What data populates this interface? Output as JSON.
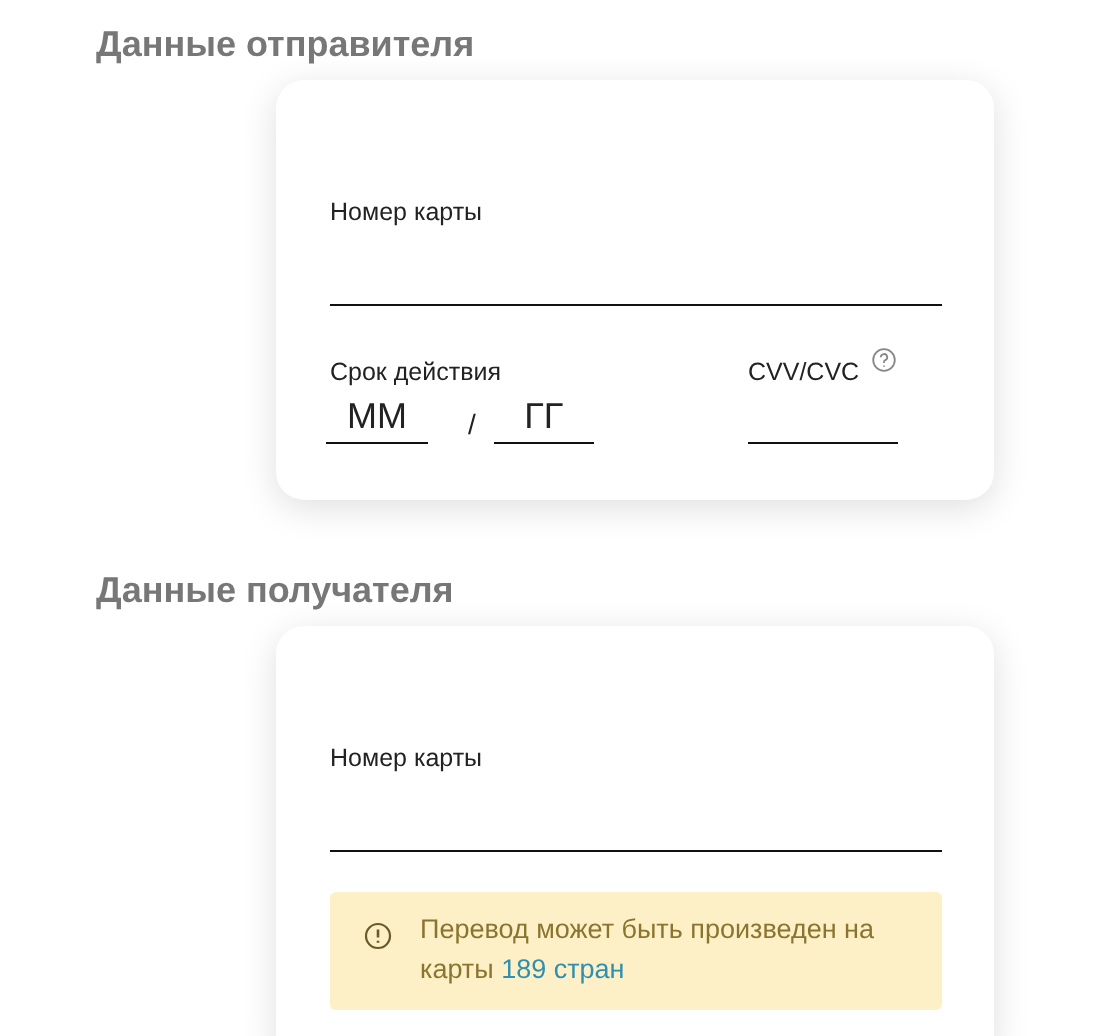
{
  "sender": {
    "title": "Данные отправителя",
    "card_number": {
      "label": "Номер карты"
    },
    "expiry": {
      "label": "Срок действия",
      "month": {
        "placeholder": "ММ"
      },
      "separator": "/",
      "year": {
        "placeholder": "ГГ"
      }
    },
    "cvv": {
      "label": "CVV/CVC"
    }
  },
  "recipient": {
    "title": "Данные получателя",
    "card_number": {
      "label": "Номер карты"
    },
    "notice": {
      "text": "Перевод может быть произведен на карты",
      "link": "189 стран"
    }
  }
}
